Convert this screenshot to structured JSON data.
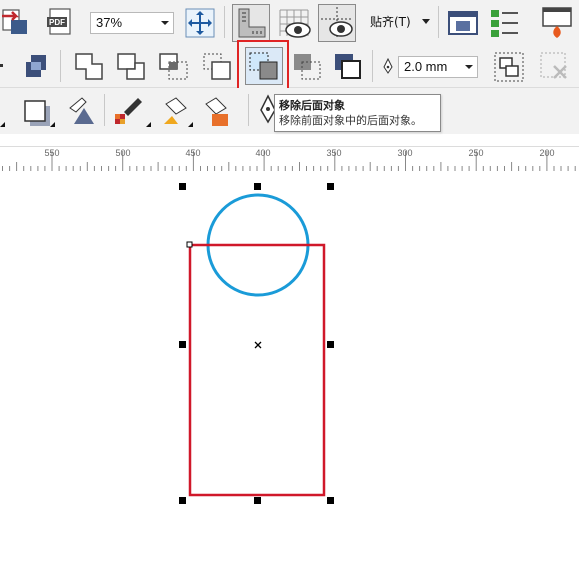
{
  "toolbar_top": {
    "zoom_value": "37%",
    "snap_label": "贴齐(T)"
  },
  "property_bar": {
    "outline_width_value": "2.0 mm"
  },
  "tooltip": {
    "title": "移除后面对象",
    "description": "移除前面对象中的后面对象。"
  },
  "ruler": {
    "labels": [
      "550",
      "500",
      "450",
      "400",
      "350",
      "300",
      "250",
      "200"
    ]
  },
  "colors": {
    "highlight_red": "#e02424",
    "circle_blue": "#1a9bd8",
    "rectangle_red": "#d0182a"
  },
  "icons": {
    "import": "import-icon",
    "export_pdf": "pdf-export-icon",
    "full_screen": "full-screen-icon",
    "rulers": "rulers-icon",
    "grid": "grid-icon",
    "guidelines": "guidelines-icon",
    "options": "options-icon",
    "welcome": "welcome-screen-icon",
    "launch": "launch-icon"
  }
}
